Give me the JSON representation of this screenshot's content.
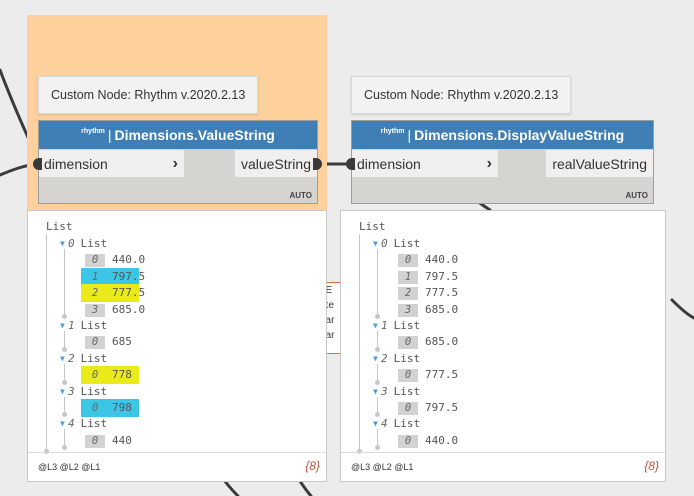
{
  "colors": {
    "header_blue": "#3f7fb5",
    "group_orange": "#fdd09c",
    "highlight_cyan": "#3cc6e6",
    "highlight_yellow": "#e9ea18",
    "count_color": "#b5553b"
  },
  "left_node": {
    "tooltip": "Custom Node: Rhythm v.2020.2.13",
    "brand": "rhythm",
    "separator": "|",
    "title": "Dimensions.ValueString",
    "input_port": "dimension",
    "output_port": "valueString",
    "run_mode": "AUTO",
    "preview": {
      "root": "List",
      "groups": [
        {
          "index": "0",
          "label": "List",
          "items": [
            {
              "index": "0",
              "value": "440.0",
              "highlight": ""
            },
            {
              "index": "1",
              "value": "797.5",
              "highlight": "cyan"
            },
            {
              "index": "2",
              "value": "777.5",
              "highlight": "yellow"
            },
            {
              "index": "3",
              "value": "685.0",
              "highlight": ""
            }
          ]
        },
        {
          "index": "1",
          "label": "List",
          "items": [
            {
              "index": "0",
              "value": "685",
              "highlight": ""
            }
          ]
        },
        {
          "index": "2",
          "label": "List",
          "items": [
            {
              "index": "0",
              "value": "778",
              "highlight": "yellow"
            }
          ]
        },
        {
          "index": "3",
          "label": "List",
          "items": [
            {
              "index": "0",
              "value": "798",
              "highlight": "cyan"
            }
          ]
        },
        {
          "index": "4",
          "label": "List",
          "items": [
            {
              "index": "0",
              "value": "440",
              "highlight": ""
            }
          ]
        }
      ],
      "levels": "@L3 @L2 @L1",
      "count": "{8}"
    }
  },
  "right_node": {
    "tooltip": "Custom Node: Rhythm v.2020.2.13",
    "brand": "rhythm",
    "separator": "|",
    "title": "Dimensions.DisplayValueString",
    "input_port": "dimension",
    "output_port": "realValueString",
    "run_mode": "AUTO",
    "preview": {
      "root": "List",
      "groups": [
        {
          "index": "0",
          "label": "List",
          "items": [
            {
              "index": "0",
              "value": "440.0",
              "highlight": ""
            },
            {
              "index": "1",
              "value": "797.5",
              "highlight": ""
            },
            {
              "index": "2",
              "value": "777.5",
              "highlight": ""
            },
            {
              "index": "3",
              "value": "685.0",
              "highlight": ""
            }
          ]
        },
        {
          "index": "1",
          "label": "List",
          "items": [
            {
              "index": "0",
              "value": "685.0",
              "highlight": ""
            }
          ]
        },
        {
          "index": "2",
          "label": "List",
          "items": [
            {
              "index": "0",
              "value": "777.5",
              "highlight": ""
            }
          ]
        },
        {
          "index": "3",
          "label": "List",
          "items": [
            {
              "index": "0",
              "value": "797.5",
              "highlight": ""
            }
          ]
        },
        {
          "index": "4",
          "label": "List",
          "items": [
            {
              "index": "0",
              "value": "440.0",
              "highlight": ""
            }
          ]
        }
      ],
      "levels": "@L3 @L2 @L1",
      "count": "{8}"
    }
  },
  "background_fragment": {
    "lines": [
      "nE",
      "nte",
      "nar",
      "nar"
    ]
  }
}
